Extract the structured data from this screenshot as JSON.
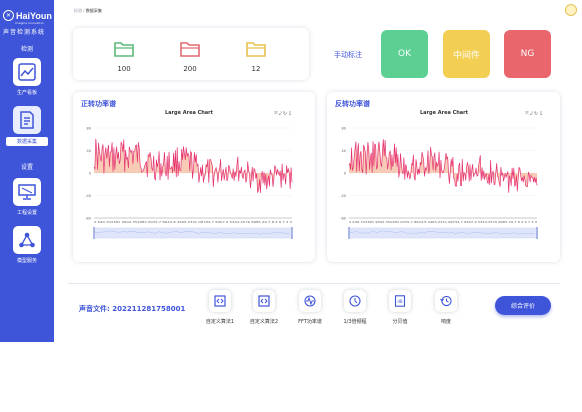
{
  "app": {
    "logo_title": "HaiYoun",
    "logo_tagline": "Imagine Innovation",
    "logo_subtitle": "声音检测系统"
  },
  "sidebar": {
    "section_detect": "检测",
    "section_settings": "设置",
    "items": [
      {
        "label": "生产看板",
        "icon": "line-chart-icon"
      },
      {
        "label": "数据采集",
        "icon": "document-edit-icon",
        "active": true
      },
      {
        "label": "工程设置",
        "icon": "monitor-icon"
      },
      {
        "label": "模型服务",
        "icon": "share-nodes-icon"
      }
    ]
  },
  "breadcrumb": {
    "root": "检测",
    "separator": "/",
    "current": "数据采集"
  },
  "stats": [
    {
      "value": "100",
      "color": "#5cb97a",
      "icon": "folder-green-icon"
    },
    {
      "value": "200",
      "color": "#e06a74",
      "icon": "folder-red-icon"
    },
    {
      "value": "12",
      "color": "#e8c34f",
      "icon": "folder-yellow-icon"
    }
  ],
  "manual_label": "手动标注",
  "label_buttons": [
    {
      "label": "OK",
      "color": "#5ccf92"
    },
    {
      "label": "中间件",
      "color": "#f2cf52"
    },
    {
      "label": "NG",
      "color": "#e8666c"
    }
  ],
  "charts": [
    {
      "panel_title": "正转功率谱",
      "chart_title": "Large Area Chart",
      "tools": [
        "zoom-icon",
        "zoom-reset-icon",
        "restore-icon",
        "download-icon"
      ],
      "yticks": [
        "80",
        "40",
        "0",
        "-40",
        "-80"
      ],
      "xaxis_text": "0 640.703381 9502.352982 0035.7 8644.8 4465.2331 08794.7 8407.9 5344.2576 8985 29.7 8 4 9 7 3 3"
    },
    {
      "panel_title": "反转功率谱",
      "chart_title": "Large Area Chart",
      "tools": [
        "zoom-icon",
        "zoom-reset-icon",
        "restore-icon",
        "download-icon"
      ],
      "yticks": [
        "80",
        "40",
        "0",
        "-40",
        "-80"
      ],
      "xaxis_text": "0 640.703381 9502.352982 0035.7 8644.8 4465.2331 08794.7 8407.9 5344.2576 8985 29.7 8 4 9 7 3 3"
    }
  ],
  "chart_colors": {
    "line": "#e5306e",
    "fill": "#f3a07a",
    "zoom": "#dfe6fb"
  },
  "sound_file": {
    "label": "声音文件:",
    "value": "202211281758001"
  },
  "tools": [
    {
      "label": "自定义算法1",
      "icon": "code-file-icon"
    },
    {
      "label": "自定义算法2",
      "icon": "code-file-icon"
    },
    {
      "label": "FFT功率谱",
      "icon": "waveform-icon"
    },
    {
      "label": "1/3倍频程",
      "icon": "clock-arrow-icon"
    },
    {
      "label": "分贝值",
      "icon": "decibel-icon"
    },
    {
      "label": "响度",
      "icon": "history-clock-icon"
    }
  ],
  "eval_button": "综合评价"
}
